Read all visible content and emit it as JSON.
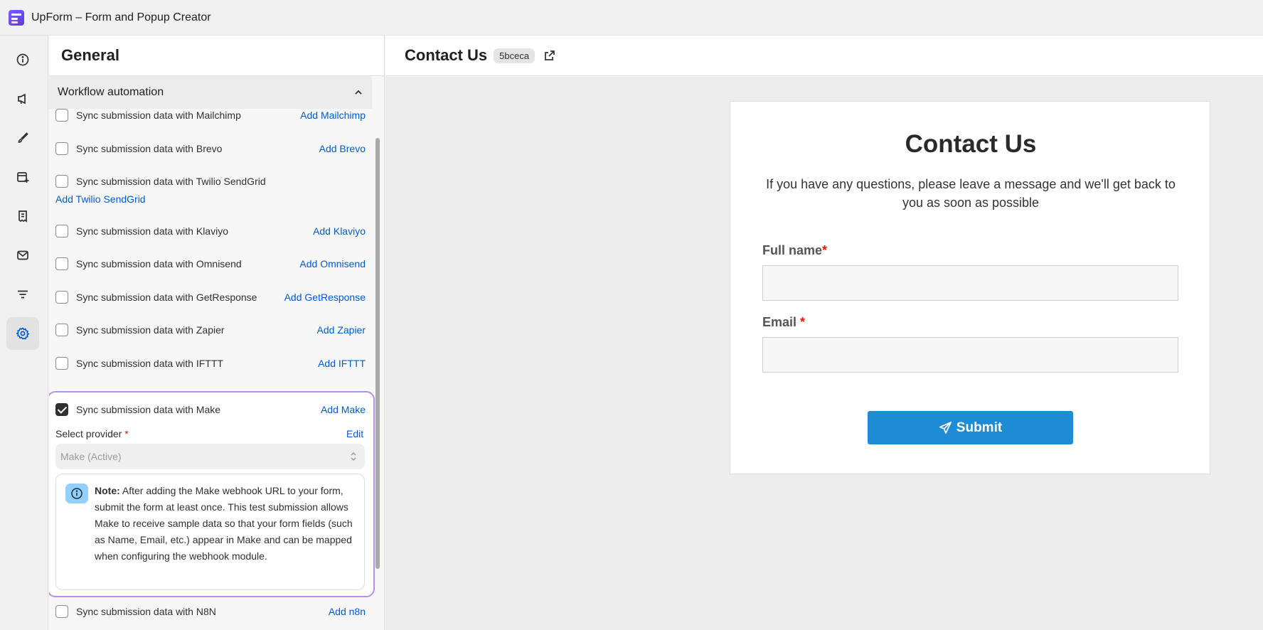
{
  "app": {
    "title": "UpForm – Form and Popup Creator"
  },
  "rail": {
    "items": [
      {
        "icon": "info-icon"
      },
      {
        "icon": "megaphone-icon"
      },
      {
        "icon": "brush-icon"
      },
      {
        "icon": "form-add-icon"
      },
      {
        "icon": "receipt-icon"
      },
      {
        "icon": "mail-icon"
      },
      {
        "icon": "filter-icon"
      },
      {
        "icon": "gear-icon",
        "active": true
      }
    ]
  },
  "panel": {
    "title": "General",
    "section_title": "Workflow automation",
    "integrations": [
      {
        "label": "Sync submission data with Mailchimp",
        "link": "Add Mailchimp",
        "checked": false
      },
      {
        "label": "Sync submission data with Brevo",
        "link": "Add Brevo",
        "checked": false
      },
      {
        "label": "Sync submission data with Twilio SendGrid",
        "link": "Add Twilio SendGrid",
        "checked": false
      },
      {
        "label": "Sync submission data with Klaviyo",
        "link": "Add Klaviyo",
        "checked": false
      },
      {
        "label": "Sync submission data with Omnisend",
        "link": "Add Omnisend",
        "checked": false
      },
      {
        "label": "Sync submission data with GetResponse",
        "link": "Add GetResponse",
        "checked": false
      },
      {
        "label": "Sync submission data with Zapier",
        "link": "Add Zapier",
        "checked": false
      },
      {
        "label": "Sync submission data with IFTTT",
        "link": "Add IFTTT",
        "checked": false
      },
      {
        "label": "Sync submission data with Make",
        "link": "Add Make",
        "checked": true
      },
      {
        "label": "Sync submission data with N8N",
        "link": "Add n8n",
        "checked": false
      }
    ],
    "make": {
      "provider_label": "Select provider",
      "required_mark": "*",
      "edit_label": "Edit",
      "select_value": "Make (Active)",
      "note_title": "Note:",
      "note_text": "After adding the Make webhook URL to your form, submit the form at least once. This test submission allows Make to receive sample data so that your form fields (such as Name, Email, etc.) appear in Make and can be mapped when configuring the webhook module."
    }
  },
  "preview": {
    "title": "Contact Us",
    "form_id": "5bceca",
    "form": {
      "title": "Contact Us",
      "description": "If you have any questions, please leave a message and we'll get back to you as soon as possible",
      "fields": [
        {
          "label": "Full name",
          "required_mark": "*"
        },
        {
          "label": "Email ",
          "required_mark": "*"
        }
      ],
      "submit_label": "Submit",
      "button_color": "#1f8bd4"
    }
  },
  "colors": {
    "accent_link": "#005bd3",
    "highlight_border": "#b68cf5",
    "required": "#e51c00"
  }
}
